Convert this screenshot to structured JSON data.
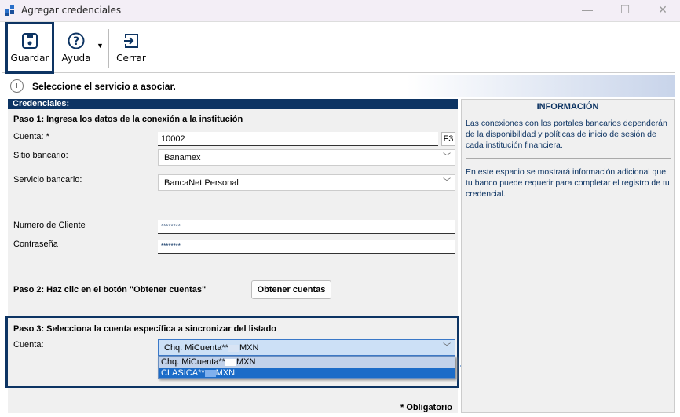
{
  "window": {
    "title": "Agregar credenciales"
  },
  "toolbar": {
    "save": "Guardar",
    "help": "Ayuda",
    "close": "Cerrar"
  },
  "info": {
    "message": "Seleccione el servicio a asociar."
  },
  "form": {
    "header": "Credenciales:",
    "step1": "Paso 1: Ingresa los datos de la conexión a la institución",
    "account_label": "Cuenta: *",
    "account_value": "10002",
    "account_key": "F3",
    "site_label": "Sitio bancario:",
    "site_value": "Banamex",
    "service_label": "Servicio bancario:",
    "service_value": "BancaNet Personal",
    "client_label": "Numero de Cliente",
    "client_value": "********",
    "password_label": "Contraseña",
    "password_value": "********",
    "step2": "Paso 2: Haz clic en el botón \"Obtener cuentas\"",
    "get_accounts": "Obtener cuentas",
    "step3": "Paso 3: Selecciona la cuenta específica a sincronizar del listado",
    "cuenta_label": "Cuenta:",
    "cuenta_selected_prefix": "Chq. MiCuenta**",
    "cuenta_selected_suffix": "MXN",
    "options": [
      {
        "prefix": "Chq. MiCuenta**",
        "suffix": "MXN"
      },
      {
        "prefix": "CLASICA**",
        "suffix": "MXN"
      }
    ],
    "required": "* Obligatorio"
  },
  "sidebar": {
    "title": "INFORMACIÓN",
    "p1": "Las conexiones con los portales bancarios dependerán de la disponibilidad y políticas de inicio de sesión de cada institución financiera.",
    "p2": "En este espacio se mostrará información adicional que tu banco puede requerir para completar el registro de tu credencial."
  }
}
